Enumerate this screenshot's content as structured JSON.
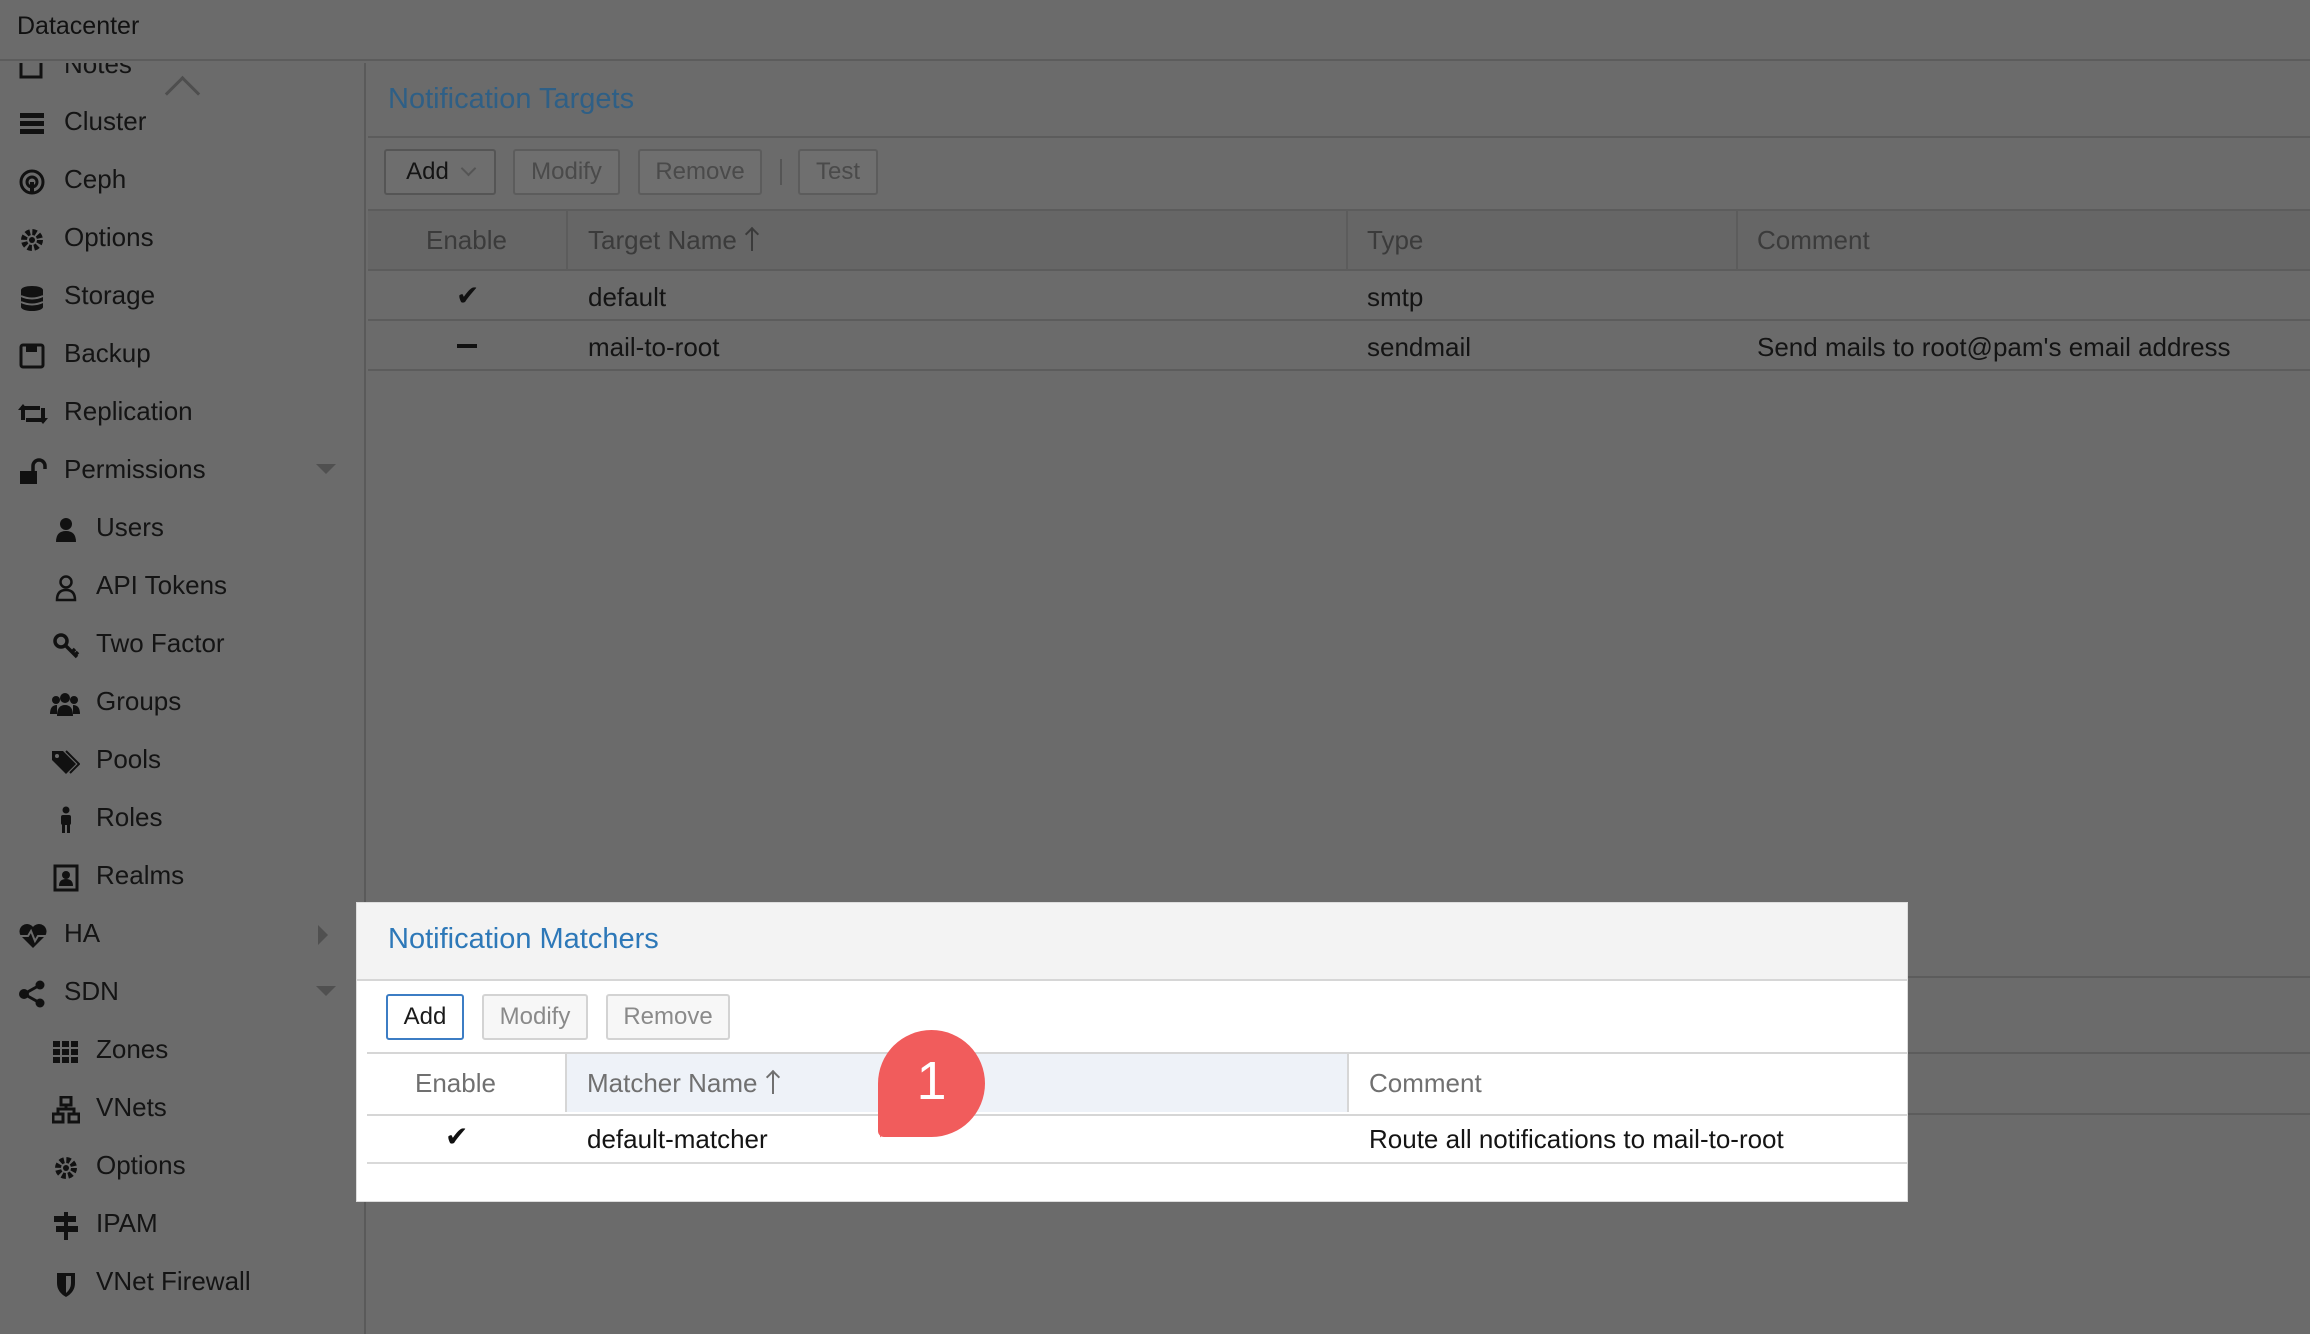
{
  "window": {
    "title": "Datacenter"
  },
  "sidebar": {
    "items": [
      {
        "label": "Notes",
        "icon": "notes-icon"
      },
      {
        "label": "Cluster",
        "icon": "cluster-icon"
      },
      {
        "label": "Ceph",
        "icon": "ceph-icon"
      },
      {
        "label": "Options",
        "icon": "gear-icon"
      },
      {
        "label": "Storage",
        "icon": "database-icon"
      },
      {
        "label": "Backup",
        "icon": "floppy-icon"
      },
      {
        "label": "Replication",
        "icon": "retweet-icon"
      },
      {
        "label": "Permissions",
        "icon": "unlock-icon",
        "expanded": true
      },
      {
        "label": "Users",
        "icon": "user-icon"
      },
      {
        "label": "API Tokens",
        "icon": "user-outline-icon"
      },
      {
        "label": "Two Factor",
        "icon": "key-icon"
      },
      {
        "label": "Groups",
        "icon": "users-icon"
      },
      {
        "label": "Pools",
        "icon": "tags-icon"
      },
      {
        "label": "Roles",
        "icon": "male-icon"
      },
      {
        "label": "Realms",
        "icon": "address-book-icon"
      },
      {
        "label": "HA",
        "icon": "heartbeat-icon",
        "expanded": false
      },
      {
        "label": "SDN",
        "icon": "sdn-icon",
        "expanded": true
      },
      {
        "label": "Zones",
        "icon": "grid-icon"
      },
      {
        "label": "VNets",
        "icon": "network-icon"
      },
      {
        "label": "Options",
        "icon": "gear-icon"
      },
      {
        "label": "IPAM",
        "icon": "signpost-icon"
      },
      {
        "label": "VNet Firewall",
        "icon": "shield-icon"
      }
    ]
  },
  "targets": {
    "title": "Notification Targets",
    "toolbar": {
      "add": "Add",
      "modify": "Modify",
      "remove": "Remove",
      "test": "Test"
    },
    "columns": {
      "enable": "Enable",
      "name": "Target Name",
      "type": "Type",
      "comment": "Comment"
    },
    "rows": [
      {
        "enabled": true,
        "name": "default",
        "type": "smtp",
        "comment": ""
      },
      {
        "enabled": false,
        "name": "mail-to-root",
        "type": "sendmail",
        "comment": "Send mails to root@pam's email address"
      }
    ]
  },
  "matchers": {
    "title": "Notification Matchers",
    "toolbar": {
      "add": "Add",
      "modify": "Modify",
      "remove": "Remove"
    },
    "columns": {
      "enable": "Enable",
      "name": "Matcher Name",
      "comment": "Comment"
    },
    "rows": [
      {
        "enabled": true,
        "name": "default-matcher",
        "comment": "Route all notifications to mail-to-root"
      }
    ]
  },
  "callout": {
    "number": "1",
    "color": "#f15c5c"
  },
  "colors": {
    "accent": "#2d78b8",
    "overlay": "#6b6b6b"
  }
}
